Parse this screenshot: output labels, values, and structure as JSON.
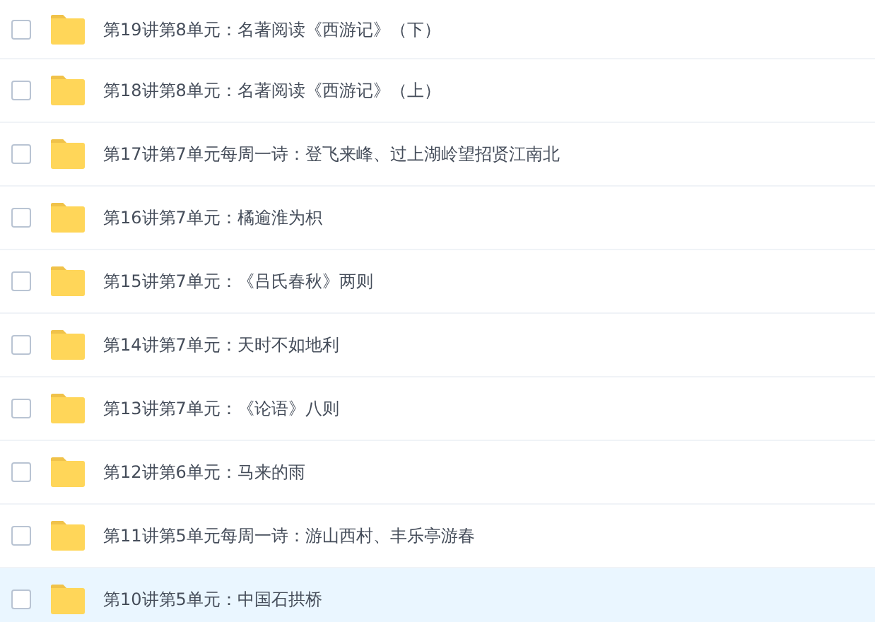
{
  "folders": [
    {
      "name": "第19讲第8单元：名著阅读《西游记》（下）",
      "checked": false,
      "hovered": false
    },
    {
      "name": "第18讲第8单元：名著阅读《西游记》（上）",
      "checked": false,
      "hovered": false
    },
    {
      "name": "第17讲第7单元每周一诗：登飞来峰、过上湖岭望招贤江南北",
      "checked": false,
      "hovered": false
    },
    {
      "name": "第16讲第7单元：橘逾淮为枳",
      "checked": false,
      "hovered": false
    },
    {
      "name": "第15讲第7单元：《吕氏春秋》两则",
      "checked": false,
      "hovered": false
    },
    {
      "name": "第14讲第7单元：天时不如地利",
      "checked": false,
      "hovered": false
    },
    {
      "name": "第13讲第7单元：《论语》八则",
      "checked": false,
      "hovered": false
    },
    {
      "name": "第12讲第6单元：马来的雨",
      "checked": false,
      "hovered": false
    },
    {
      "name": "第11讲第5单元每周一诗：游山西村、丰乐亭游春",
      "checked": false,
      "hovered": false
    },
    {
      "name": "第10讲第5单元：中国石拱桥",
      "checked": false,
      "hovered": true
    }
  ]
}
